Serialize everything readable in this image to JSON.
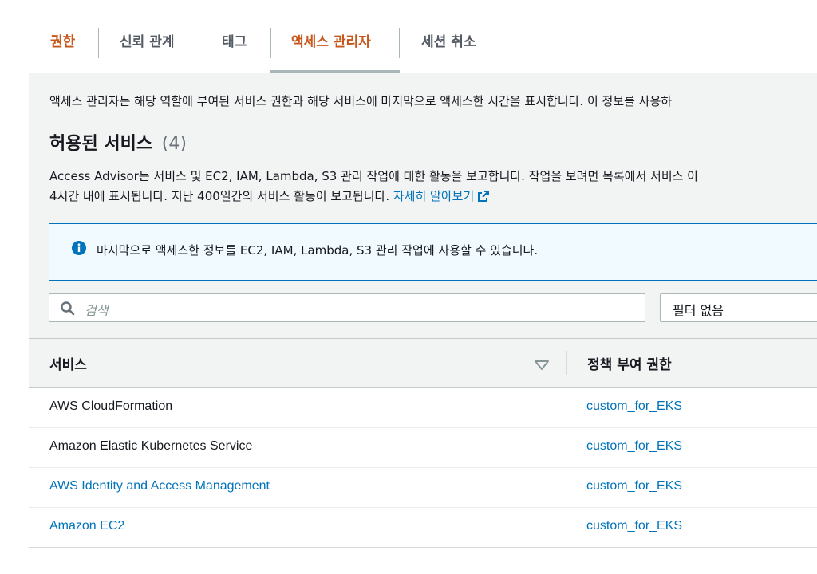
{
  "tabs": [
    {
      "label": "권한"
    },
    {
      "label": "신뢰 관계"
    },
    {
      "label": "태그"
    },
    {
      "label": "액세스 관리자"
    },
    {
      "label": "세션 취소"
    }
  ],
  "intro_text": "액세스 관리자는 해당 역할에 부여된 서비스 권한과 해당 서비스에 마지막으로 액세스한 시간을 표시합니다. 이 정보를 사용하",
  "section": {
    "title": "허용된 서비스",
    "count": "(4)",
    "desc_line1": "Access Advisor는 서비스 및 EC2, IAM, Lambda, S3 관리 작업에 대한 활동을 보고합니다. 작업을 보려면 목록에서 서비스 이",
    "desc_line2": "4시간 내에 표시됩니다. 지난 400일간의 서비스 활동이 보고됩니다.",
    "learn_more": "자세히 알아보기"
  },
  "info_box": {
    "text": "마지막으로 액세스한 정보를 EC2, IAM, Lambda, S3 관리 작업에 사용할 수 있습니다."
  },
  "search": {
    "placeholder": "검색"
  },
  "filter": {
    "value": "필터 없음"
  },
  "table": {
    "columns": [
      "서비스",
      "정책 부여 권한"
    ],
    "rows": [
      {
        "service": "AWS CloudFormation",
        "policy": "custom_for_EKS"
      },
      {
        "service": "Amazon Elastic Kubernetes Service",
        "policy": "custom_for_EKS"
      },
      {
        "service": "AWS Identity and Access Management",
        "policy": "custom_for_EKS"
      },
      {
        "service": "Amazon EC2",
        "policy": "custom_for_EKS"
      }
    ]
  },
  "colors": {
    "accent": "#c7571b",
    "link": "#0073bb",
    "info_border": "#0073bb"
  }
}
